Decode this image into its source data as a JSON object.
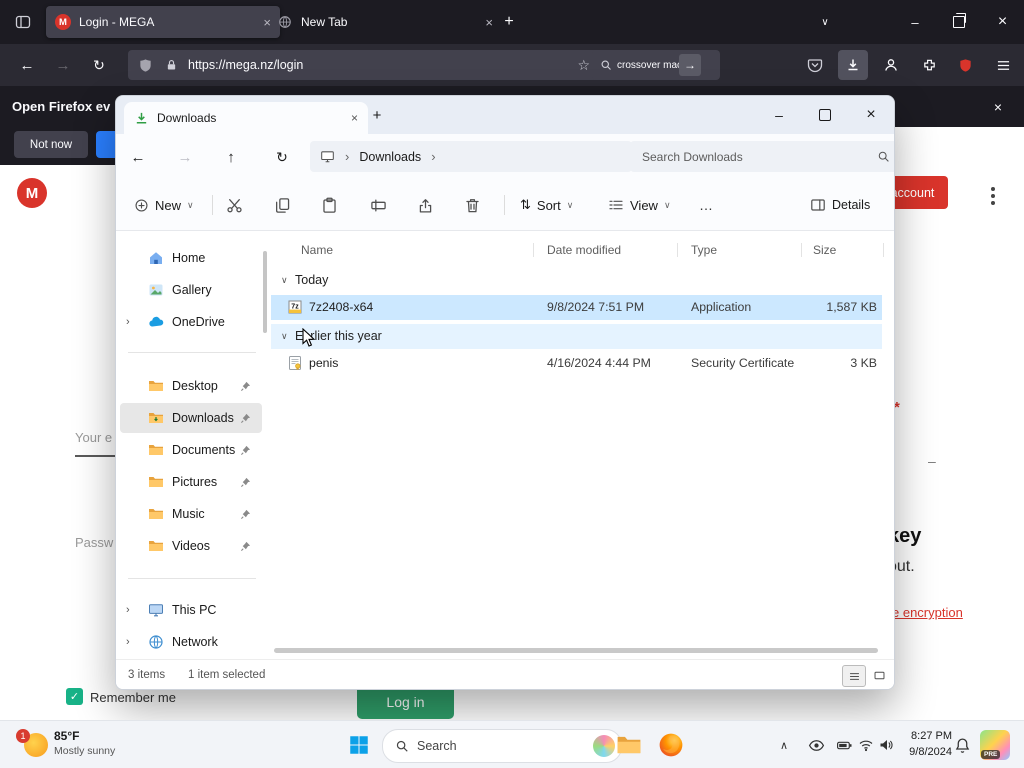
{
  "browser": {
    "tabs": [
      {
        "title": "Login - MEGA"
      },
      {
        "title": "New Tab"
      }
    ],
    "url": "https://mega.nz/login",
    "search_query": "crossover mac dow",
    "infobar_title": "Open Firefox ev",
    "doorhanger_secondary": "Not now"
  },
  "mega": {
    "logo_letter": "M",
    "account_button": "account",
    "email_fragment": "Your e",
    "password_fragment": "Passw",
    "required_mark": "*",
    "dash_fragment": "–",
    "key_fragment": "key",
    "out_fragment": "out.",
    "encryption_link": "e encryption",
    "remember_label": "Remember me",
    "login_button": "Log in"
  },
  "explorer": {
    "tab_title": "Downloads",
    "breadcrumb": {
      "folder": "Downloads"
    },
    "search_placeholder": "Search Downloads",
    "toolbar": {
      "new_label": "New",
      "sort_label": "Sort",
      "view_label": "View",
      "more_label": "…",
      "details_label": "Details"
    },
    "sidebar": {
      "items": [
        {
          "label": "Home"
        },
        {
          "label": "Gallery"
        },
        {
          "label": "OneDrive"
        },
        {
          "label": "Desktop"
        },
        {
          "label": "Downloads"
        },
        {
          "label": "Documents"
        },
        {
          "label": "Pictures"
        },
        {
          "label": "Music"
        },
        {
          "label": "Videos"
        },
        {
          "label": "This PC"
        },
        {
          "label": "Network"
        }
      ]
    },
    "columns": {
      "name": "Name",
      "date": "Date modified",
      "type": "Type",
      "size": "Size"
    },
    "groups": [
      {
        "label": "Today",
        "files": [
          {
            "name": "7z2408-x64",
            "date": "9/8/2024 7:51 PM",
            "type": "Application",
            "size": "1,587 KB",
            "selected": true
          }
        ]
      },
      {
        "label": "Earlier this year",
        "files": [
          {
            "name": "penis",
            "date": "4/16/2024 4:44 PM",
            "type": "Security Certificate",
            "size": "3 KB",
            "selected": false
          }
        ]
      }
    ],
    "status": {
      "count": "3 items",
      "selected": "1 item selected"
    }
  },
  "taskbar": {
    "weather": {
      "badge": "1",
      "temp": "85°F",
      "condition": "Mostly sunny"
    },
    "search_label": "Search",
    "clock": {
      "time": "8:27 PM",
      "date": "9/8/2024"
    },
    "pre_badge": "PRE"
  },
  "icons": {
    "back": "←",
    "forward": "→",
    "up": "↑",
    "refresh": "↻",
    "star": "☆",
    "plus": "+",
    "close": "×",
    "minimize": "–",
    "chevron_down": "∨",
    "chevron_up": "∧",
    "chevron_right": "›",
    "more": "…",
    "sort": "⇅",
    "go": "→",
    "check": "✓"
  },
  "colors": {
    "mega_red": "#d9342b",
    "login_green": "#2f9e69",
    "selection_blue": "#cce8ff",
    "accent_blue": "#2a7fff",
    "folder_yellow": "#f8b64c"
  }
}
